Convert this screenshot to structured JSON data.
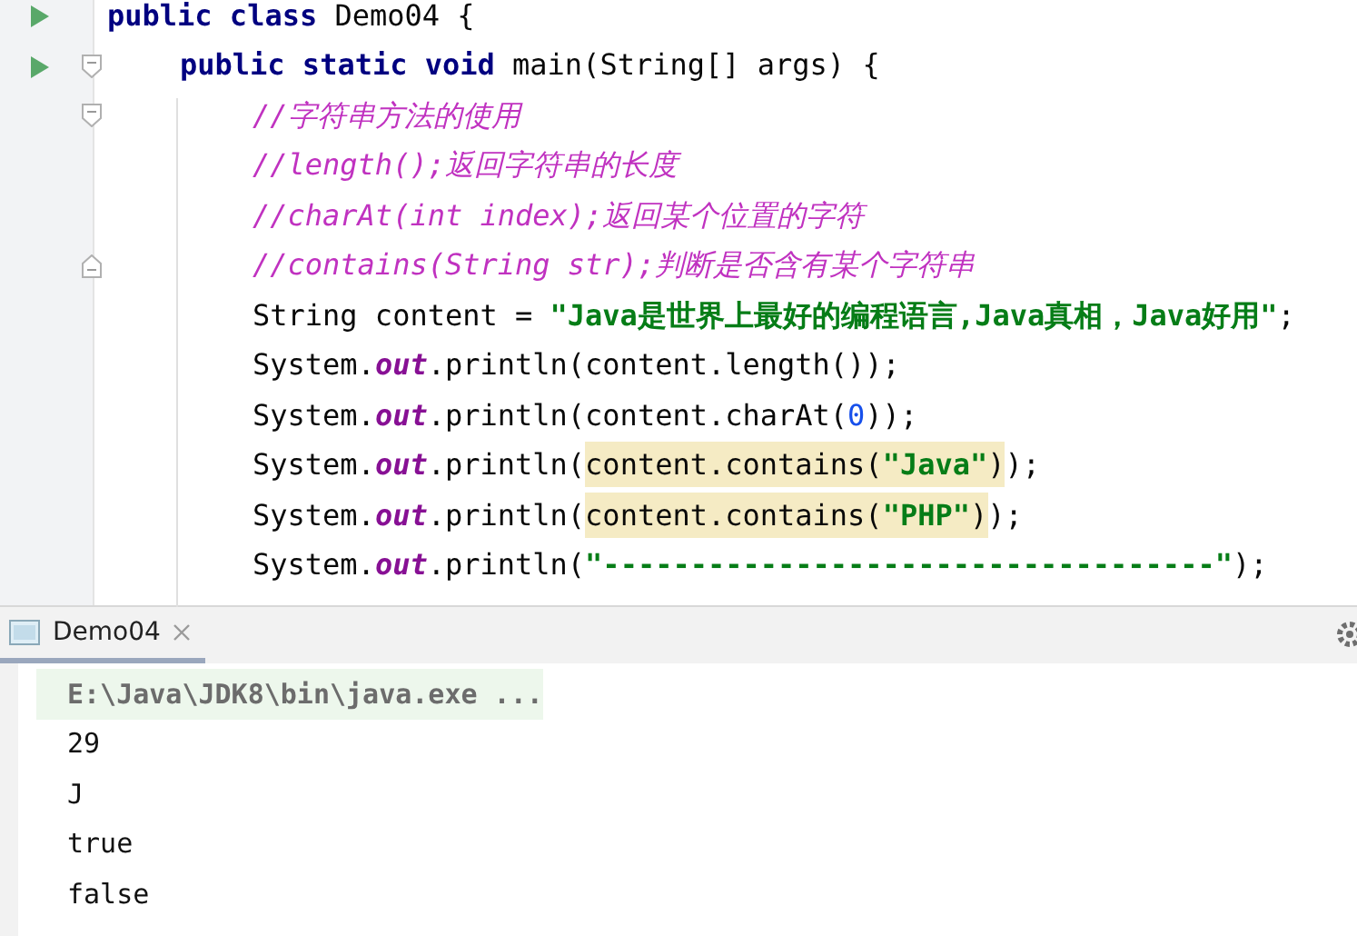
{
  "editor": {
    "lines": [
      {
        "run": true,
        "fold_start": false,
        "fold_end": false,
        "tokens": [
          {
            "kind": "keyword",
            "text": "public class "
          },
          {
            "kind": "plain",
            "text": "Demo04 {"
          }
        ],
        "children": [
          {
            "run": true,
            "fold_start": true,
            "fold_end": false,
            "tokens": [
              {
                "kind": "keyword",
                "text": "public static void "
              },
              {
                "kind": "plain",
                "text": "main(String[] args) {"
              }
            ],
            "children": [
              {
                "run": false,
                "fold_start": true,
                "fold_end": false,
                "tokens": [
                  {
                    "kind": "comment",
                    "text": "//字符串方法的使用"
                  }
                ]
              },
              {
                "run": false,
                "fold_start": false,
                "fold_end": false,
                "tokens": [
                  {
                    "kind": "comment",
                    "text": "//length();返回字符串的长度"
                  }
                ]
              },
              {
                "run": false,
                "fold_start": false,
                "fold_end": false,
                "tokens": [
                  {
                    "kind": "comment",
                    "text": "//charAt(int index);返回某个位置的字符"
                  }
                ]
              },
              {
                "run": false,
                "fold_start": false,
                "fold_end": true,
                "tokens": [
                  {
                    "kind": "comment",
                    "text": "//contains(String str);判断是否含有某个字符串"
                  }
                ]
              },
              {
                "run": false,
                "fold_start": false,
                "fold_end": false,
                "tokens": [
                  {
                    "kind": "plain",
                    "text": "String content = "
                  },
                  {
                    "kind": "string",
                    "text": "\"Java是世界上最好的编程语言,Java真相，Java好用\""
                  },
                  {
                    "kind": "plain",
                    "text": ";"
                  }
                ]
              },
              {
                "run": false,
                "fold_start": false,
                "fold_end": false,
                "tokens": [
                  {
                    "kind": "plain",
                    "text": "System."
                  },
                  {
                    "kind": "field",
                    "text": "out"
                  },
                  {
                    "kind": "plain",
                    "text": ".println(content.length());"
                  }
                ]
              },
              {
                "run": false,
                "fold_start": false,
                "fold_end": false,
                "tokens": [
                  {
                    "kind": "plain",
                    "text": "System."
                  },
                  {
                    "kind": "field",
                    "text": "out"
                  },
                  {
                    "kind": "plain",
                    "text": ".println(content.charAt("
                  },
                  {
                    "kind": "number",
                    "text": "0"
                  },
                  {
                    "kind": "plain",
                    "text": "));"
                  }
                ]
              },
              {
                "run": false,
                "fold_start": false,
                "fold_end": false,
                "tokens": [
                  {
                    "kind": "plain",
                    "text": "System."
                  },
                  {
                    "kind": "field",
                    "text": "out"
                  },
                  {
                    "kind": "plain",
                    "text": ".println("
                  },
                  {
                    "kind": "plain",
                    "text": "content.contains(",
                    "highlighted": true
                  },
                  {
                    "kind": "string",
                    "text": "\"Java\"",
                    "highlighted": true
                  },
                  {
                    "kind": "plain",
                    "text": ")",
                    "highlighted": true
                  },
                  {
                    "kind": "plain",
                    "text": ");",
                    "highlighted": false
                  }
                ]
              },
              {
                "run": false,
                "fold_start": false,
                "fold_end": false,
                "tokens": [
                  {
                    "kind": "plain",
                    "text": "System."
                  },
                  {
                    "kind": "field",
                    "text": "out"
                  },
                  {
                    "kind": "plain",
                    "text": ".println("
                  },
                  {
                    "kind": "plain",
                    "text": "content.contains(",
                    "highlighted": true
                  },
                  {
                    "kind": "string",
                    "text": "\"PHP\"",
                    "highlighted": true
                  },
                  {
                    "kind": "plain",
                    "text": ")",
                    "highlighted": true
                  },
                  {
                    "kind": "plain",
                    "text": ");",
                    "highlighted": false
                  }
                ]
              },
              {
                "run": false,
                "fold_start": false,
                "fold_end": false,
                "tokens": [
                  {
                    "kind": "plain",
                    "text": "System."
                  },
                  {
                    "kind": "field",
                    "text": "out"
                  },
                  {
                    "kind": "plain",
                    "text": ".println("
                  },
                  {
                    "kind": "string",
                    "text": "\"-----------------------------------\""
                  },
                  {
                    "kind": "plain",
                    "text": ");"
                  }
                ]
              }
            ]
          }
        ]
      }
    ]
  },
  "run_panel": {
    "tabs": [
      {
        "label": "Demo04",
        "selected": true
      }
    ],
    "console": [
      {
        "kind": "command",
        "text": "E:\\Java\\JDK8\\bin\\java.exe ..."
      },
      {
        "kind": "output",
        "text": "29"
      },
      {
        "kind": "output",
        "text": "J"
      },
      {
        "kind": "output",
        "text": "true"
      },
      {
        "kind": "output",
        "text": "false"
      }
    ]
  }
}
